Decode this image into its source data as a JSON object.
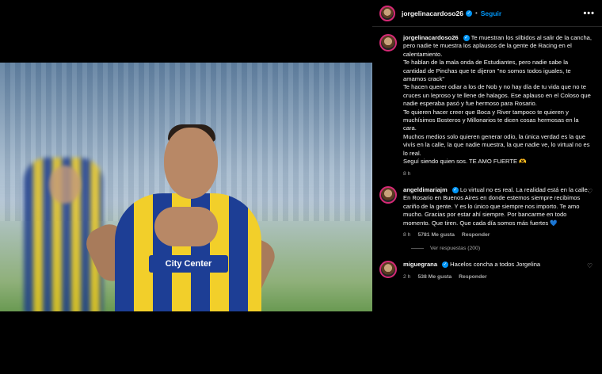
{
  "header": {
    "username": "jorgelinacardoso26",
    "separator": "•",
    "follow_label": "Seguir",
    "more_label": "•••"
  },
  "photo": {
    "sponsor_text": "City Center"
  },
  "caption": {
    "username": "jorgelinacardoso26",
    "lines": [
      "Te muestran los silbidos al salir de la cancha, pero nadie te muestra los aplausos de la gente de Racing en el calentamiento.",
      "Te hablan de la mala onda de Estudiantes, pero nadie sabe la cantidad de Pinchas que te dijeron \"no somos todos iguales, te amamos crack\"",
      "Te hacen querer odiar a los de Nob y no hay día de tu vida que no te cruces un leproso y te llene de halagos. Ese aplauso en el Coloso que nadie esperaba pasó y fue hermoso para Rosario.",
      "Te quieren hacer creer que Boca y River tampoco te quieren y muchísimos Bosteros y Millonarios te dicen cosas hermosas en la cara.",
      "Muchos medios solo quieren generar odio, la única verdad es la que vivís en la calle, la que nadie muestra, la que nadie ve, lo virtual no es lo real.",
      "Seguí siendo quien sos. TE AMO FUERTE"
    ],
    "emoji": "🫶",
    "time": "8 h"
  },
  "comments": [
    {
      "username": "angeldimariajm",
      "text": "Lo virtual no es real. La realidad está en la calle. En Rosario en Buenos Aires en donde estemos siempre recibimos cariño de la gente. Y es lo único que siempre nos importo. Te amo mucho. Gracias por estar ahí siempre. Por bancarme en todo momento. Que tiren. Que cada día somos más fuertes",
      "emoji": "💙",
      "time": "8 h",
      "likes": "5781 Me gusta",
      "reply_label": "Responder",
      "view_replies": "Ver respuestas (200)"
    },
    {
      "username": "miguegrana",
      "text": "Hacelos concha a todos Jorgelina",
      "time": "2 h",
      "likes": "538 Me gusta",
      "reply_label": "Responder"
    }
  ],
  "icons": {
    "verified": "verified-badge-icon",
    "heart": "heart-outline-icon",
    "user_tag": "person-icon"
  },
  "colors": {
    "accent_blue": "#0095f6",
    "background": "#000000",
    "text_primary": "#f5f5f5",
    "text_secondary": "#a8a8a8"
  }
}
